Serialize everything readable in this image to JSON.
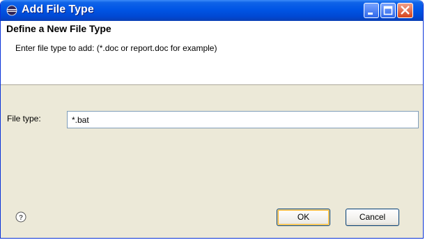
{
  "window": {
    "title": "Add File Type"
  },
  "header": {
    "title": "Define a New File Type",
    "description": "Enter file type to add: (*.doc or report.doc for example)"
  },
  "form": {
    "file_type_label": "File type:",
    "file_type_value": "*.bat"
  },
  "buttons": {
    "ok_label": "OK",
    "cancel_label": "Cancel"
  },
  "icons": {
    "app": "eclipse-icon",
    "minimize": "minimize-icon",
    "maximize": "maximize-icon",
    "close": "close-icon",
    "help": "help-icon"
  },
  "colors": {
    "titlebar": "#0055e5",
    "dialog_bg": "#ece9d8",
    "close_button": "#d7441c"
  }
}
